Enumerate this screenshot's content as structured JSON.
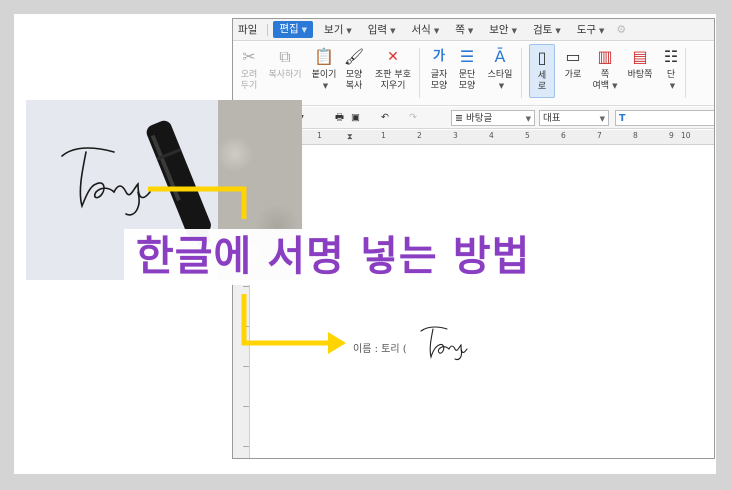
{
  "menu": {
    "items": [
      {
        "label": "파일",
        "caret": false
      },
      {
        "label": "편집",
        "caret": true,
        "active": true
      },
      {
        "label": "보기",
        "caret": true
      },
      {
        "label": "입력",
        "caret": true
      },
      {
        "label": "서식",
        "caret": true
      },
      {
        "label": "쪽",
        "caret": true
      },
      {
        "label": "보안",
        "caret": true
      },
      {
        "label": "검토",
        "caret": true
      },
      {
        "label": "도구",
        "caret": true
      }
    ]
  },
  "ribbon": {
    "cut": {
      "line1": "오려",
      "line2": "두기"
    },
    "copy": {
      "line1": "복사하기"
    },
    "paste": {
      "line1": "붙이기"
    },
    "format_copy": {
      "line1": "모양",
      "line2": "복사"
    },
    "erase_markers": {
      "line1": "조판 부호",
      "line2": "지우기"
    },
    "char_shape": {
      "line1": "글자",
      "line2": "모양"
    },
    "para_shape": {
      "line1": "문단",
      "line2": "모양"
    },
    "style": {
      "line1": "스타일"
    },
    "portrait": {
      "line1": "세로"
    },
    "landscape": {
      "line1": "가로"
    },
    "page_margin": {
      "line1": "쪽",
      "line2": "여백"
    },
    "background": {
      "line1": "바탕쪽"
    },
    "columns": {
      "line1": "단"
    }
  },
  "toolbar": {
    "style_value": "바탕글",
    "font_value": "대표"
  },
  "ruler": {
    "numbers": [
      "1",
      "1",
      "2",
      "3",
      "4",
      "5",
      "6",
      "7",
      "8",
      "9",
      "10"
    ]
  },
  "document": {
    "field_label": "이름 : 토리 (",
    "signature_text": "Tory"
  },
  "overlay": {
    "headline": "한글에 서명 넣는 방법"
  },
  "colors": {
    "headline": "#8a3ec2",
    "arrow": "#ffd400",
    "menu_active": "#2b79d6"
  }
}
